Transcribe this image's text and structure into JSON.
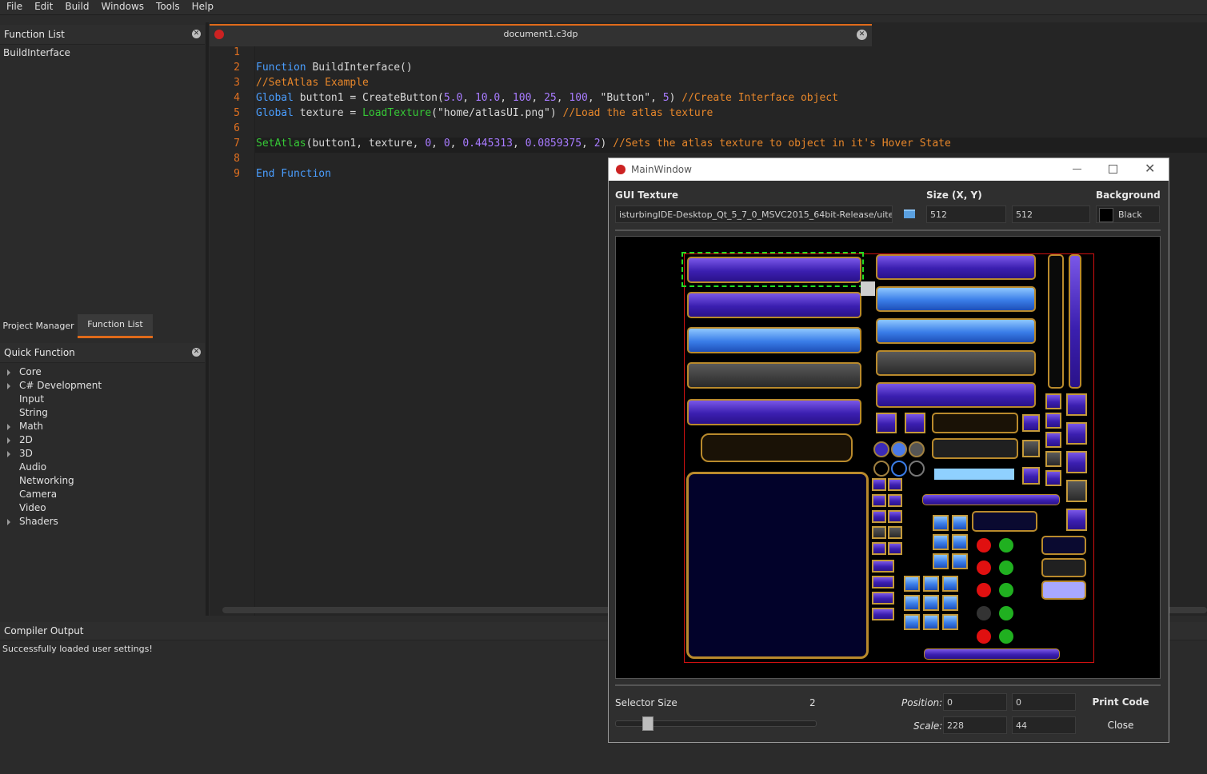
{
  "menu": [
    "File",
    "Edit",
    "Build",
    "Windows",
    "Tools",
    "Help"
  ],
  "function_list": {
    "title": "Function List",
    "items": [
      "BuildInterface"
    ]
  },
  "left_tabs": [
    "Project Manager",
    "Function List"
  ],
  "quick_function": {
    "title": "Quick Function",
    "items": [
      {
        "label": "Core",
        "expandable": true
      },
      {
        "label": "C# Development",
        "expandable": true
      },
      {
        "label": "Input",
        "expandable": false
      },
      {
        "label": "String",
        "expandable": false
      },
      {
        "label": "Math",
        "expandable": true
      },
      {
        "label": "2D",
        "expandable": true
      },
      {
        "label": "3D",
        "expandable": true
      },
      {
        "label": "Audio",
        "expandable": false
      },
      {
        "label": "Networking",
        "expandable": false
      },
      {
        "label": "Camera",
        "expandable": false
      },
      {
        "label": "Video",
        "expandable": false
      },
      {
        "label": "Shaders",
        "expandable": true
      }
    ]
  },
  "editor": {
    "tab_title": "document1.c3dp",
    "line_numbers": [
      "1",
      "2",
      "3",
      "4",
      "5",
      "6",
      "7",
      "8",
      "9"
    ]
  },
  "compiler": {
    "title": "Compiler Output",
    "message": "Successfully loaded user settings!"
  },
  "dialog": {
    "title": "MainWindow",
    "gui_texture_label": "GUI Texture",
    "texture_path": "isturbingIDE-Desktop_Qt_5_7_0_MSVC2015_64bit-Release/uitest.png",
    "size_label": "Size (X, Y)",
    "size_x": "512",
    "size_y": "512",
    "background_label": "Background",
    "background_value": "Black",
    "selector_size_label": "Selector Size",
    "selector_size_value": "2",
    "position_label": "Position:",
    "position_x": "0",
    "position_y": "0",
    "scale_label": "Scale:",
    "scale_x": "228",
    "scale_y": "44",
    "print_code": "Print Code",
    "close": "Close",
    "slider_fraction": 0.14
  },
  "colors": {
    "accent": "#e06a1a",
    "keyword": "#4a9eff",
    "comment": "#e6862a",
    "function": "#36c936",
    "number": "#a87bff"
  }
}
